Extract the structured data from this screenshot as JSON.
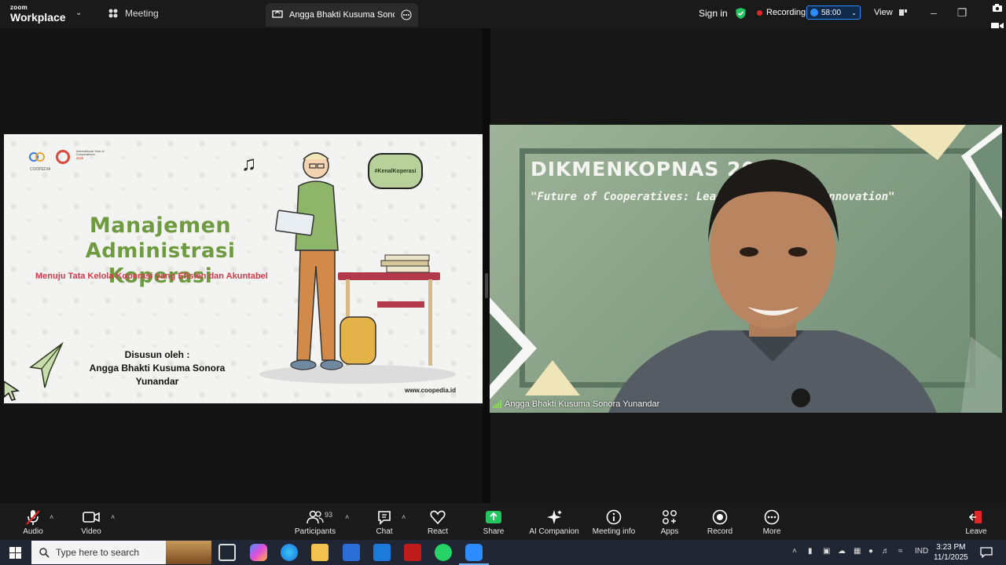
{
  "titlebar": {
    "logo_small": "zoom",
    "logo_big": "Workplace",
    "meeting_label": "Meeting",
    "tab_label": "Angga Bhakti Kusuma Sonora Yunandar",
    "sign_in": "Sign in",
    "recording": "Recording",
    "timer": "58:00",
    "view": "View"
  },
  "slide": {
    "title_line1": "Manajemen",
    "title_line2": "Administrasi Koperasi",
    "subtitle": "Menuju Tata Kelola Koperasi yang Efisien dan Akuntabel",
    "by_label": "Disusun oleh :",
    "by_name": "Angga Bhakti Kusuma Sonora Yunandar",
    "url": "www.coopedia.id",
    "hashtag": "#KenalKoperasi",
    "logo_org": "COOPEDIA",
    "logo_year_text": "International Year of Cooperatives",
    "logo_year": "2025"
  },
  "video": {
    "banner_title": "DIKMENKOPNAS 20",
    "banner_subtitle": "\"Future of Cooperatives: Lead          en Z Innovation\"",
    "participant_name": "Angga Bhakti Kusuma Sonora Yunandar"
  },
  "toolbar": {
    "audio": "Audio",
    "video": "Video",
    "participants": "Participants",
    "participants_count": "93",
    "chat": "Chat",
    "react": "React",
    "share": "Share",
    "ai_companion": "AI Companion",
    "meeting_info": "Meeting info",
    "apps": "Apps",
    "record": "Record",
    "more": "More",
    "leave": "Leave"
  },
  "taskbar": {
    "search_placeholder": "Type here to search",
    "language": "IND",
    "time": "3:23 PM",
    "date": "11/1/2025"
  },
  "colors": {
    "zoom_blue": "#2d8cff",
    "share_green": "#22c55e",
    "record_red": "#e02828",
    "leave_red": "#e02828",
    "slide_title_green": "#6e9a40",
    "slide_subtitle_red": "#d8394a"
  }
}
